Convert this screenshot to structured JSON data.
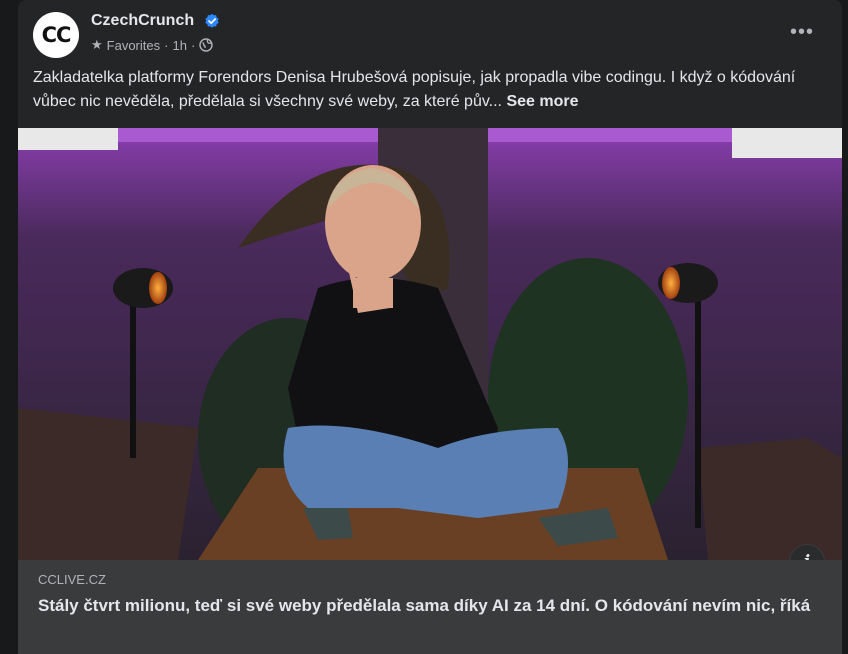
{
  "post": {
    "page_name": "CzechCrunch",
    "avatar_text": "CC",
    "audience": "Favorites",
    "time": "1h",
    "separator": "·",
    "more_dots": "•••",
    "caption": "Zakladatelka platformy Forendors Denisa Hrubešová popisuje, jak propadla vibe codingu. I když o kódování vůbec nic nevěděla, předělala si všechny své weby, za které pův...",
    "see_more": "See more",
    "info_glyph": "i"
  },
  "link": {
    "domain": "CCLIVE.CZ",
    "title": "Stály čtvrt milionu, teď si své weby předělala sama díky AI za 14 dní. O kódování nevím nic, říká"
  },
  "colors": {
    "background": "#18191a",
    "card": "#242526",
    "link_box": "#3a3b3c",
    "verified": "#2d88ff",
    "text_primary": "#e4e6eb",
    "text_secondary": "#b0b3b8"
  },
  "icons": [
    "verified-badge-icon",
    "star-icon",
    "globe-icon",
    "more-options-icon",
    "info-icon"
  ]
}
